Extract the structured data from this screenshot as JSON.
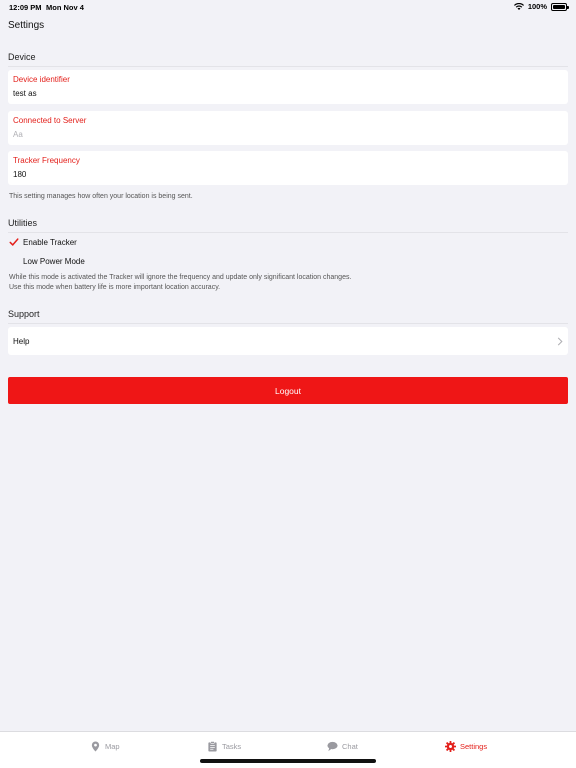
{
  "status_bar": {
    "time": "12:09 PM",
    "date": "Mon Nov 4",
    "battery": "100%"
  },
  "page": {
    "title": "Settings"
  },
  "device": {
    "header": "Device",
    "identifier": {
      "label": "Device identifier",
      "value": "test as"
    },
    "server": {
      "label": "Connected to Server",
      "placeholder": "Aa"
    },
    "frequency": {
      "label": "Tracker Frequency",
      "value": "180"
    },
    "hint": "This setting manages how often your location is being sent."
  },
  "utilities": {
    "header": "Utilities",
    "enable_tracker": {
      "label": "Enable Tracker",
      "checked": true
    },
    "low_power": {
      "label": "Low Power Mode",
      "checked": false
    },
    "hint_line1": "While this mode is activated the Tracker will ignore the frequency and update only significant location changes.",
    "hint_line2": "Use this mode when battery life is more important location accuracy."
  },
  "support": {
    "header": "Support",
    "help_label": "Help"
  },
  "logout_label": "Logout",
  "colors": {
    "accent": "#e3201b",
    "logout": "#ef1616",
    "inactive_tab": "#9a9aa0"
  },
  "tabs": [
    {
      "label": "Map",
      "icon": "map-pin-icon",
      "active": false
    },
    {
      "label": "Tasks",
      "icon": "clipboard-icon",
      "active": false
    },
    {
      "label": "Chat",
      "icon": "chat-bubble-icon",
      "active": false
    },
    {
      "label": "Settings",
      "icon": "gear-icon",
      "active": true
    }
  ]
}
